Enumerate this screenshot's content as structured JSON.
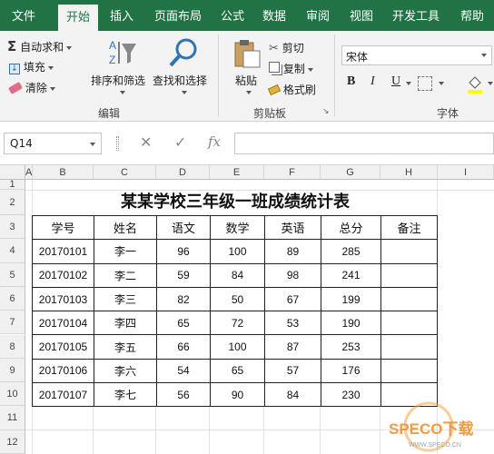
{
  "ribbon_tabs": [
    "文件",
    "开始",
    "插入",
    "页面布局",
    "公式",
    "数据",
    "审阅",
    "视图",
    "开发工具",
    "帮助"
  ],
  "ribbon": {
    "autosum_label": "自动求和",
    "fill_label": "填充",
    "clear_label": "清除",
    "sort_filter_label": "排序和筛选",
    "find_select_label": "查找和选择",
    "edit_group": "编辑",
    "paste_label": "粘贴",
    "cut_label": "剪切",
    "copy_label": "复制",
    "format_painter_label": "格式刷",
    "clipboard_group": "剪贴板",
    "font_name": "宋体",
    "font_group": "字体",
    "bold_label": "B",
    "italic_label": "I",
    "underline_label": "U"
  },
  "formula_bar": {
    "name_box": "Q14",
    "cancel_symbol": "✕",
    "enter_symbol": "✓",
    "fx_symbol": "fx",
    "formula": ""
  },
  "grid": {
    "columns": [
      "A",
      "B",
      "C",
      "D",
      "E",
      "F",
      "G",
      "H",
      "I"
    ],
    "rows": [
      "1",
      "2",
      "3",
      "4",
      "5",
      "6",
      "7",
      "8",
      "9",
      "10",
      "11",
      "12"
    ]
  },
  "sheet": {
    "title": "某某学校三年级一班成绩统计表",
    "headers": [
      "学号",
      "姓名",
      "语文",
      "数学",
      "英语",
      "总分",
      "备注"
    ],
    "rows": [
      [
        "20170101",
        "李一",
        "96",
        "100",
        "89",
        "285",
        ""
      ],
      [
        "20170102",
        "李二",
        "59",
        "84",
        "98",
        "241",
        ""
      ],
      [
        "20170103",
        "李三",
        "82",
        "50",
        "67",
        "199",
        ""
      ],
      [
        "20170104",
        "李四",
        "65",
        "72",
        "53",
        "190",
        ""
      ],
      [
        "20170105",
        "李五",
        "66",
        "100",
        "87",
        "253",
        ""
      ],
      [
        "20170106",
        "李六",
        "54",
        "65",
        "57",
        "176",
        ""
      ],
      [
        "20170107",
        "李七",
        "56",
        "90",
        "84",
        "230",
        ""
      ]
    ]
  },
  "watermark": {
    "text": "SPECO下载",
    "subtext": "WWW.SPECO.CN"
  },
  "colors": {
    "accent": "#217346",
    "ribbon_bg": "#f3f3f3"
  }
}
